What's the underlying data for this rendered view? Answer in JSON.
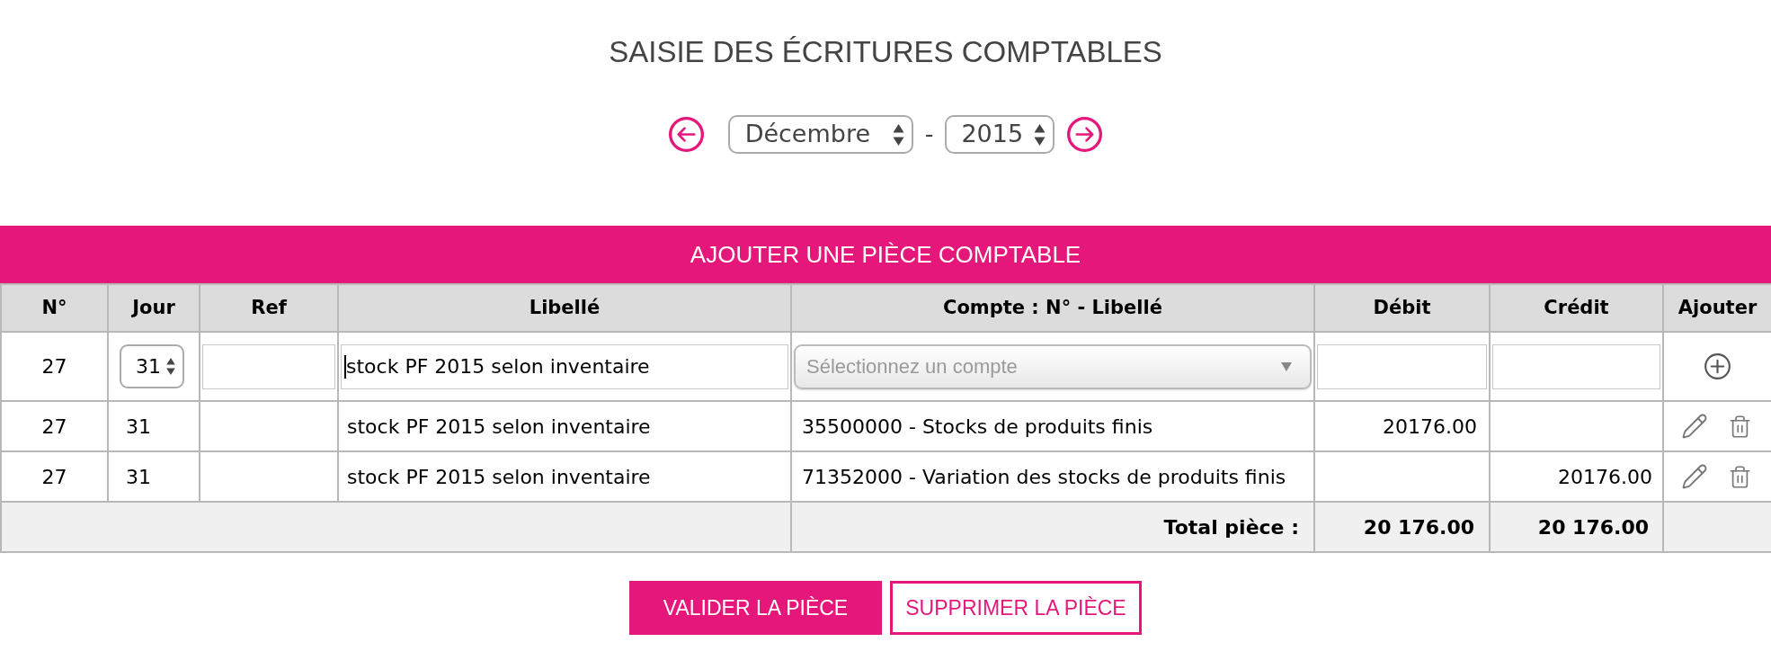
{
  "title": "SAISIE DES ÉCRITURES COMPTABLES",
  "period": {
    "month": "Décembre",
    "separator": "-",
    "year": "2015"
  },
  "entry_form": {
    "title": "AJOUTER UNE PIÈCE COMPTABLE",
    "columns": [
      "N°",
      "Jour",
      "Ref",
      "Libellé",
      "Compte : N° - Libellé",
      "Débit",
      "Crédit",
      "Ajouter"
    ],
    "entry_row": {
      "number": "27",
      "day": "31",
      "label": {
        "value": "stock PF 2015 selon inventaire",
        "focused": true
      },
      "account": {
        "placeholder": "Sélectionnez un compte"
      }
    },
    "rows": [
      {
        "number": "27",
        "day": "31",
        "label": "stock PF 2015 selon inventaire",
        "account": "35500000 - Stocks de produits finis",
        "debit": "20176.00"
      },
      {
        "number": "27",
        "day": "31",
        "label": "stock PF 2015 selon inventaire",
        "account": "71352000 - Variation des stocks de produits finis",
        "credit": "20176.00"
      }
    ],
    "total": {
      "label": "Total pièce :",
      "debit": "20 176.00",
      "credit": "20 176.00"
    }
  },
  "buttons": [
    {
      "label": "VALIDER LA PIÈCE",
      "kind": "primary"
    },
    {
      "label": "SUPPRIMER LA PIÈCE",
      "kind": "outline"
    }
  ]
}
